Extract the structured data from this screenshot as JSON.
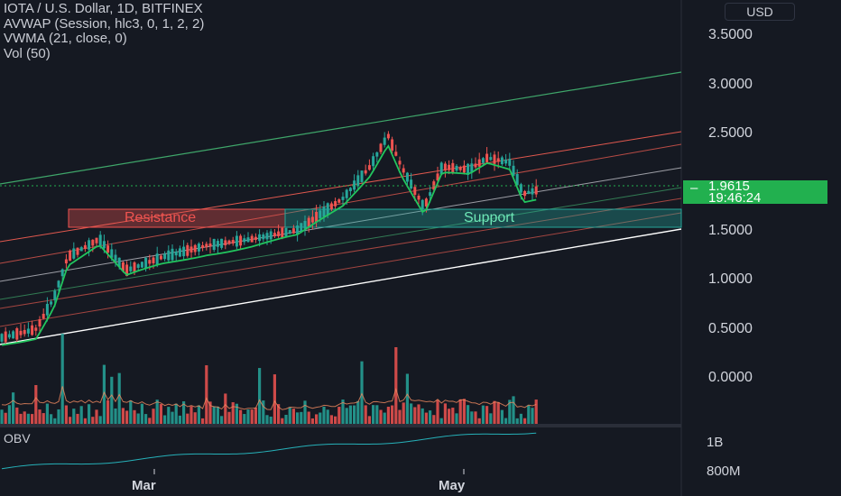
{
  "legend": {
    "symbol": "IOTA / U.S. Dollar, 1D, BITFINEX",
    "avwap": "AVWAP (Session, hlc3, 0, 1, 2, 2)",
    "vwma": "VWMA (21, close, 0)",
    "vol": "Vol (50)"
  },
  "currency": "USD",
  "price_tag": {
    "price": "1.9615",
    "countdown": "19:46:24",
    "color": "#22b04f"
  },
  "price_axis": [
    "3.5000",
    "3.0000",
    "2.5000",
    "1.5000",
    "1.0000",
    "0.5000",
    "0.0000"
  ],
  "time_axis": [
    "Mar",
    "May"
  ],
  "annotations": {
    "resistance": "Resistance",
    "support": "Support"
  },
  "obv": {
    "label": "OBV",
    "axis": [
      "1B",
      "800M"
    ]
  },
  "colors": {
    "up": "#26a69a",
    "down": "#ef5350",
    "background": "#151922"
  }
}
